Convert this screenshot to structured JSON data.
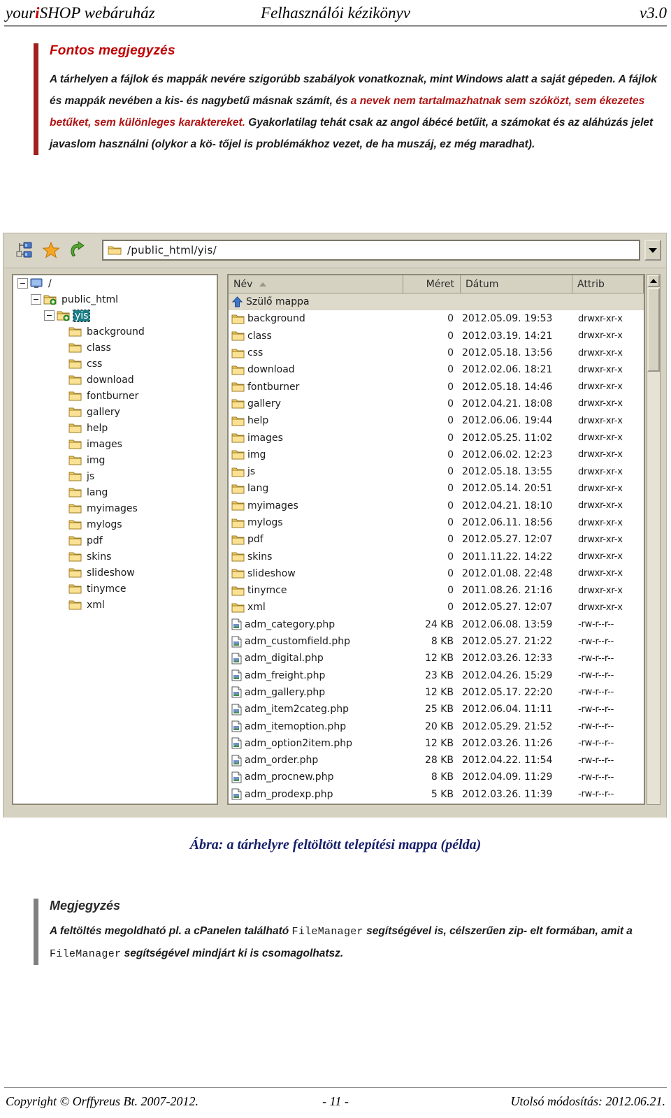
{
  "header": {
    "left_pre": "your",
    "left_i": "i",
    "left_post": "SHOP webáruház",
    "center": "Felhasználói kézikönyv",
    "right": "v3.0"
  },
  "important_note": {
    "title": "Fontos megjegyzés",
    "line1": "A tárhelyen a fájlok és mappák nevére szigorúbb szabályok vonatkoznak, mint Windows alatt a",
    "line2_plain": "saját gépeden. A fájlok és mappák nevében a kis- és nagybetű másnak számít, és ",
    "line2_red": "a nevek nem",
    "line3_red": "tartalmazhatnak sem szóközt, sem ékezetes betűket, sem különleges karaktereket.",
    "line3_plain": " Gyakorlatilag",
    "line4": "tehát csak az angol ábécé betűit, a számokat és az aláhúzás jelet javaslom használni (olykor a kö-",
    "line5": "tőjel is problémákhoz vezet, de ha muszáj, ez még maradhat)."
  },
  "ftp": {
    "toolbar": {
      "site_manager_icon": "site-manager-icon",
      "bookmark_icon": "star-icon",
      "refresh_icon": "refresh-arrow-icon",
      "path_value": "/public_html/yis/",
      "path_placeholder": "/",
      "dropdown_icon": "chevron-down-icon"
    },
    "tree": [
      {
        "label": "/",
        "depth": 0,
        "twisty": "−",
        "icon": "computer-icon",
        "selected": false
      },
      {
        "label": "public_html",
        "depth": 1,
        "twisty": "−",
        "icon": "folder-plus-icon",
        "selected": false
      },
      {
        "label": "yis",
        "depth": 2,
        "twisty": "−",
        "icon": "folder-plus-icon",
        "selected": true
      },
      {
        "label": "background",
        "depth": 3,
        "twisty": "",
        "icon": "folder-icon",
        "selected": false
      },
      {
        "label": "class",
        "depth": 3,
        "twisty": "",
        "icon": "folder-icon",
        "selected": false
      },
      {
        "label": "css",
        "depth": 3,
        "twisty": "",
        "icon": "folder-icon",
        "selected": false
      },
      {
        "label": "download",
        "depth": 3,
        "twisty": "",
        "icon": "folder-icon",
        "selected": false
      },
      {
        "label": "fontburner",
        "depth": 3,
        "twisty": "",
        "icon": "folder-icon",
        "selected": false
      },
      {
        "label": "gallery",
        "depth": 3,
        "twisty": "",
        "icon": "folder-icon",
        "selected": false
      },
      {
        "label": "help",
        "depth": 3,
        "twisty": "",
        "icon": "folder-icon",
        "selected": false
      },
      {
        "label": "images",
        "depth": 3,
        "twisty": "",
        "icon": "folder-icon",
        "selected": false
      },
      {
        "label": "img",
        "depth": 3,
        "twisty": "",
        "icon": "folder-icon",
        "selected": false
      },
      {
        "label": "js",
        "depth": 3,
        "twisty": "",
        "icon": "folder-icon",
        "selected": false
      },
      {
        "label": "lang",
        "depth": 3,
        "twisty": "",
        "icon": "folder-icon",
        "selected": false
      },
      {
        "label": "myimages",
        "depth": 3,
        "twisty": "",
        "icon": "folder-icon",
        "selected": false
      },
      {
        "label": "mylogs",
        "depth": 3,
        "twisty": "",
        "icon": "folder-icon",
        "selected": false
      },
      {
        "label": "pdf",
        "depth": 3,
        "twisty": "",
        "icon": "folder-icon",
        "selected": false
      },
      {
        "label": "skins",
        "depth": 3,
        "twisty": "",
        "icon": "folder-icon",
        "selected": false
      },
      {
        "label": "slideshow",
        "depth": 3,
        "twisty": "",
        "icon": "folder-icon",
        "selected": false
      },
      {
        "label": "tinymce",
        "depth": 3,
        "twisty": "",
        "icon": "folder-icon",
        "selected": false
      },
      {
        "label": "xml",
        "depth": 3,
        "twisty": "",
        "icon": "folder-icon",
        "selected": false
      }
    ],
    "columns": [
      "Név",
      "Méret",
      "Dátum",
      "Attrib"
    ],
    "sort_indicator": "ascending",
    "rows": [
      {
        "name": "Szülő mappa",
        "size": "",
        "date": "",
        "attr": "",
        "icon": "up-arrow-icon",
        "parent": true
      },
      {
        "name": "background",
        "size": "0",
        "date": "2012.05.09. 19:53",
        "attr": "drwxr-xr-x",
        "icon": "folder-icon"
      },
      {
        "name": "class",
        "size": "0",
        "date": "2012.03.19. 14:21",
        "attr": "drwxr-xr-x",
        "icon": "folder-icon"
      },
      {
        "name": "css",
        "size": "0",
        "date": "2012.05.18. 13:56",
        "attr": "drwxr-xr-x",
        "icon": "folder-icon"
      },
      {
        "name": "download",
        "size": "0",
        "date": "2012.02.06. 18:21",
        "attr": "drwxr-xr-x",
        "icon": "folder-icon"
      },
      {
        "name": "fontburner",
        "size": "0",
        "date": "2012.05.18. 14:46",
        "attr": "drwxr-xr-x",
        "icon": "folder-icon"
      },
      {
        "name": "gallery",
        "size": "0",
        "date": "2012.04.21. 18:08",
        "attr": "drwxr-xr-x",
        "icon": "folder-icon"
      },
      {
        "name": "help",
        "size": "0",
        "date": "2012.06.06. 19:44",
        "attr": "drwxr-xr-x",
        "icon": "folder-icon"
      },
      {
        "name": "images",
        "size": "0",
        "date": "2012.05.25. 11:02",
        "attr": "drwxr-xr-x",
        "icon": "folder-icon"
      },
      {
        "name": "img",
        "size": "0",
        "date": "2012.06.02. 12:23",
        "attr": "drwxr-xr-x",
        "icon": "folder-icon"
      },
      {
        "name": "js",
        "size": "0",
        "date": "2012.05.18. 13:55",
        "attr": "drwxr-xr-x",
        "icon": "folder-icon"
      },
      {
        "name": "lang",
        "size": "0",
        "date": "2012.05.14. 20:51",
        "attr": "drwxr-xr-x",
        "icon": "folder-icon"
      },
      {
        "name": "myimages",
        "size": "0",
        "date": "2012.04.21. 18:10",
        "attr": "drwxr-xr-x",
        "icon": "folder-icon"
      },
      {
        "name": "mylogs",
        "size": "0",
        "date": "2012.06.11. 18:56",
        "attr": "drwxr-xr-x",
        "icon": "folder-icon"
      },
      {
        "name": "pdf",
        "size": "0",
        "date": "2012.05.27. 12:07",
        "attr": "drwxr-xr-x",
        "icon": "folder-icon"
      },
      {
        "name": "skins",
        "size": "0",
        "date": "2011.11.22. 14:22",
        "attr": "drwxr-xr-x",
        "icon": "folder-icon"
      },
      {
        "name": "slideshow",
        "size": "0",
        "date": "2012.01.08. 22:48",
        "attr": "drwxr-xr-x",
        "icon": "folder-icon"
      },
      {
        "name": "tinymce",
        "size": "0",
        "date": "2011.08.26. 21:16",
        "attr": "drwxr-xr-x",
        "icon": "folder-icon"
      },
      {
        "name": "xml",
        "size": "0",
        "date": "2012.05.27. 12:07",
        "attr": "drwxr-xr-x",
        "icon": "folder-icon"
      },
      {
        "name": "adm_category.php",
        "size": "24 KB",
        "date": "2012.06.08. 13:59",
        "attr": "-rw-r--r--",
        "icon": "php-file-icon"
      },
      {
        "name": "adm_customfield.php",
        "size": "8 KB",
        "date": "2012.05.27. 21:22",
        "attr": "-rw-r--r--",
        "icon": "php-file-icon"
      },
      {
        "name": "adm_digital.php",
        "size": "12 KB",
        "date": "2012.03.26. 12:33",
        "attr": "-rw-r--r--",
        "icon": "php-file-icon"
      },
      {
        "name": "adm_freight.php",
        "size": "23 KB",
        "date": "2012.04.26. 15:29",
        "attr": "-rw-r--r--",
        "icon": "php-file-icon"
      },
      {
        "name": "adm_gallery.php",
        "size": "12 KB",
        "date": "2012.05.17. 22:20",
        "attr": "-rw-r--r--",
        "icon": "php-file-icon"
      },
      {
        "name": "adm_item2categ.php",
        "size": "25 KB",
        "date": "2012.06.04. 11:11",
        "attr": "-rw-r--r--",
        "icon": "php-file-icon"
      },
      {
        "name": "adm_itemoption.php",
        "size": "20 KB",
        "date": "2012.05.29. 21:52",
        "attr": "-rw-r--r--",
        "icon": "php-file-icon"
      },
      {
        "name": "adm_option2item.php",
        "size": "12 KB",
        "date": "2012.03.26. 11:26",
        "attr": "-rw-r--r--",
        "icon": "php-file-icon"
      },
      {
        "name": "adm_order.php",
        "size": "28 KB",
        "date": "2012.04.22. 11:54",
        "attr": "-rw-r--r--",
        "icon": "php-file-icon"
      },
      {
        "name": "adm_procnew.php",
        "size": "8 KB",
        "date": "2012.04.09. 11:29",
        "attr": "-rw-r--r--",
        "icon": "php-file-icon"
      },
      {
        "name": "adm_prodexp.php",
        "size": "5 KB",
        "date": "2012.03.26. 11:39",
        "attr": "-rw-r--r--",
        "icon": "php-file-icon"
      }
    ]
  },
  "figure_caption": "Ábra: a tárhelyre feltöltött telepítési mappa (példa)",
  "plain_note": {
    "title": "Megjegyzés",
    "l1a": "A feltöltés megoldható pl. a cPanelen található ",
    "l1m": "FileManager",
    "l1b": " segítségével is, célszerűen zip-",
    "l2a": "elt formában, amit a ",
    "l2m": "FileManager",
    "l2b": " segítségével mindjárt ki is csomagolhatsz."
  },
  "footer": {
    "left": "Copyright © Orffyreus Bt. 2007-2012.",
    "center": "- 11 -",
    "right": "Utolsó módosítás: 2012.06.21."
  },
  "colors": {
    "accent_red": "#c00000",
    "note_bar_red": "#a02020",
    "note_bar_gray": "#808080",
    "caption_navy": "#16206b",
    "selection_teal": "#1a7f86",
    "chrome": "#d6d2c2"
  }
}
